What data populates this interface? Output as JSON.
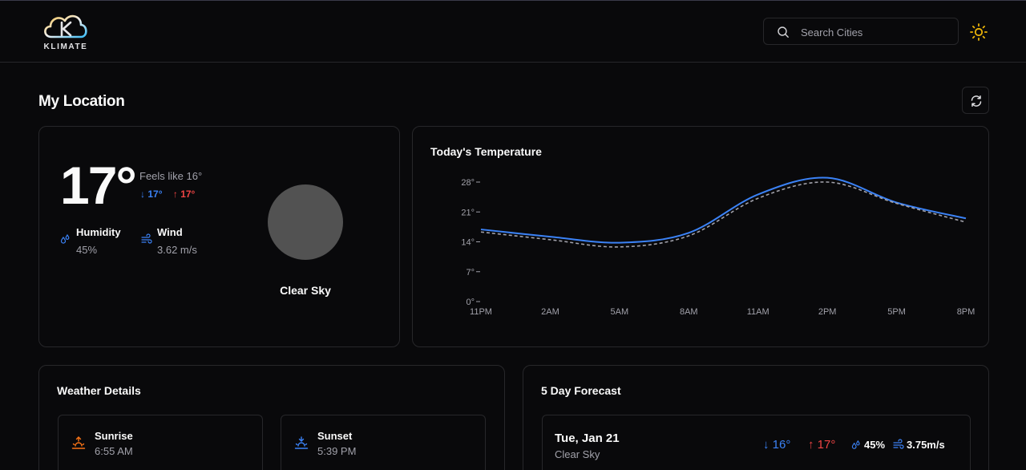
{
  "app": {
    "name": "KLIMATE"
  },
  "colors": {
    "background": "#09090b",
    "border": "#27272a",
    "muted": "#a1a1aa",
    "min": "#3b82f6",
    "max": "#ef4444",
    "sun": "#eab308",
    "sunrise": "#f97316",
    "sunset": "#3b82f6"
  },
  "search": {
    "placeholder": "Search Cities",
    "icon": "search-icon"
  },
  "theme_toggle": {
    "icon": "sun-icon"
  },
  "page": {
    "title": "My Location",
    "refresh_icon": "refresh-icon"
  },
  "current": {
    "temp": "17°",
    "feels_like": "Feels like 16°",
    "min": "17°",
    "max": "17°",
    "humidity_label": "Humidity",
    "humidity_value": "45%",
    "wind_label": "Wind",
    "wind_value": "3.62 m/s",
    "description": "Clear Sky"
  },
  "chart_data": {
    "type": "line",
    "title": "Today's Temperature",
    "x": [
      "11PM",
      "2AM",
      "5AM",
      "8AM",
      "11AM",
      "2PM",
      "5PM",
      "8PM"
    ],
    "y_ticks": [
      "0°",
      "7°",
      "14°",
      "21°",
      "28°"
    ],
    "ylim": [
      0,
      28
    ],
    "grid": false,
    "series": [
      {
        "style": "solid",
        "color": "#3b82f6",
        "values": [
          16.9,
          15.2,
          13.8,
          16.1,
          25.1,
          29.0,
          23.2,
          19.5
        ]
      },
      {
        "style": "dashed",
        "color": "#a1a1aa",
        "values": [
          16.3,
          14.5,
          12.8,
          15.4,
          24.2,
          28.0,
          23.0,
          18.6
        ]
      }
    ]
  },
  "details": {
    "title": "Weather Details",
    "sunrise_label": "Sunrise",
    "sunrise_value": "6:55 AM",
    "sunset_label": "Sunset",
    "sunset_value": "5:39 PM"
  },
  "forecast": {
    "title": "5 Day Forecast",
    "days": [
      {
        "date": "Tue, Jan 21",
        "desc": "Clear Sky",
        "min": "16°",
        "max": "17°",
        "humidity": "45%",
        "wind": "3.75m/s"
      }
    ]
  }
}
